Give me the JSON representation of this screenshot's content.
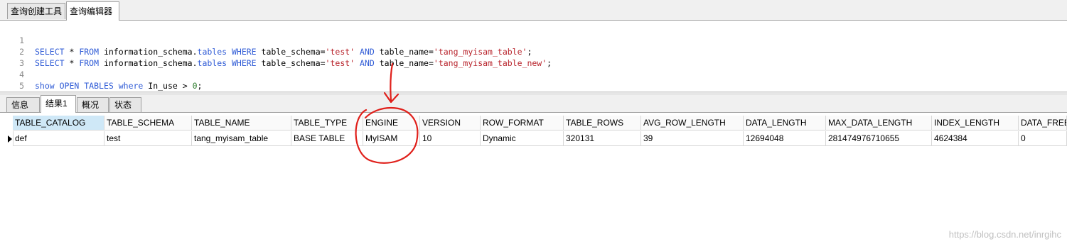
{
  "top_tabs": [
    {
      "label": "查询创建工具",
      "active": false
    },
    {
      "label": "查询编辑器",
      "active": true
    }
  ],
  "editor": {
    "lines": [
      {
        "num": "1"
      },
      {
        "num": "2"
      },
      {
        "num": "3"
      },
      {
        "num": "4"
      },
      {
        "num": "5"
      }
    ],
    "tokens": {
      "select": "SELECT",
      "star": " * ",
      "from": "FROM",
      "info": " information_schema.",
      "tables": "tables",
      "where": " WHERE ",
      "ts": "table_schema=",
      "test": "'test'",
      "and": " AND ",
      "tn": "table_name=",
      "t1": "'tang_myisam_table'",
      "t2": "'tang_myisam_table_new'",
      "semi": ";",
      "show": "show",
      "open": " OPEN TABLES ",
      "wh": "where",
      "inuse": " In_use > ",
      "zero": "0"
    }
  },
  "result_tabs": [
    {
      "label": "信息",
      "active": false
    },
    {
      "label": "结果1",
      "active": true
    },
    {
      "label": "概况",
      "active": false
    },
    {
      "label": "状态",
      "active": false
    }
  ],
  "table": {
    "columns": [
      "TABLE_CATALOG",
      "TABLE_SCHEMA",
      "TABLE_NAME",
      "TABLE_TYPE",
      "ENGINE",
      "VERSION",
      "ROW_FORMAT",
      "TABLE_ROWS",
      "AVG_ROW_LENGTH",
      "DATA_LENGTH",
      "MAX_DATA_LENGTH",
      "INDEX_LENGTH",
      "DATA_FREE"
    ],
    "rows": [
      [
        "def",
        "test",
        "tang_myisam_table",
        "BASE TABLE",
        "MyISAM",
        "10",
        "Dynamic",
        "320131",
        "39",
        "12694048",
        "281474976710655",
        "4624384",
        "0"
      ]
    ]
  },
  "watermark": "https://blog.csdn.net/inrgihc",
  "colors": {
    "annotation": "#e0201b",
    "keyword": "#2f5bd6",
    "string": "#b8232b"
  }
}
